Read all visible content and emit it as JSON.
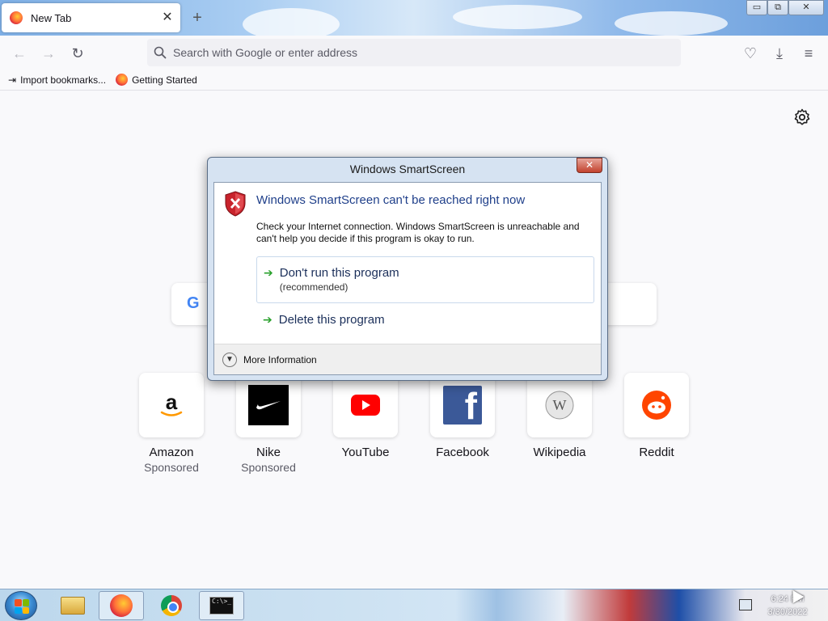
{
  "browser": {
    "tab": {
      "title": "New Tab",
      "close": "✕"
    },
    "new_tab": "+",
    "window_controls": {
      "minimize": "▭",
      "restore": "⧉",
      "close": "✕"
    },
    "nav": {
      "back": "←",
      "forward": "→",
      "reload": "↻"
    },
    "urlbar": {
      "placeholder": "Search with Google or enter address",
      "value": ""
    },
    "toolbar": {
      "pocket": "♡",
      "downloads": "⤓",
      "menu": "≡"
    },
    "bookmarks": [
      {
        "label": "Import bookmarks...",
        "icon": "import-icon"
      },
      {
        "label": "Getting Started",
        "icon": "firefox-icon"
      }
    ]
  },
  "newtab": {
    "settings_icon": "gear-icon",
    "search_logo": "G",
    "tiles": [
      {
        "name": "Amazon",
        "sub": "Sponsored",
        "icon": "amazon-icon"
      },
      {
        "name": "Nike",
        "sub": "Sponsored",
        "icon": "nike-icon"
      },
      {
        "name": "YouTube",
        "sub": "",
        "icon": "youtube-icon"
      },
      {
        "name": "Facebook",
        "sub": "",
        "icon": "facebook-icon"
      },
      {
        "name": "Wikipedia",
        "sub": "",
        "icon": "wikipedia-icon"
      },
      {
        "name": "Reddit",
        "sub": "",
        "icon": "reddit-icon"
      }
    ]
  },
  "dialog": {
    "title": "Windows SmartScreen",
    "close": "✕",
    "heading": "Windows SmartScreen can't be reached right now",
    "text": "Check your Internet connection. Windows SmartScreen is unreachable and can't help you decide if this program is okay to run.",
    "option1": {
      "label": "Don't run this program",
      "sub": "(recommended)"
    },
    "option2": {
      "label": "Delete this program"
    },
    "more": "More Information"
  },
  "taskbar": {
    "clock_time": "6:24 PM",
    "clock_date": "3/30/2022",
    "cmd_text": "C:\\>_"
  },
  "colors": {
    "dialog_heading": "#1f3f8a",
    "arrow_green": "#2aa12d",
    "youtube_red": "#ff0000",
    "facebook_blue": "#3b5998",
    "reddit_orange": "#ff4500"
  }
}
